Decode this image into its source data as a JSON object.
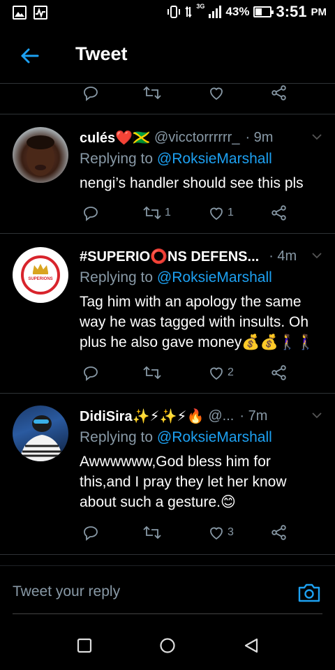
{
  "statusbar": {
    "network_label": "3G",
    "battery_percent": "43%",
    "battery_level": 0.43,
    "time": "3:51",
    "ampm": "PM"
  },
  "header": {
    "title": "Tweet"
  },
  "top_actions": {
    "reply_count": "",
    "retweet_count": "",
    "like_count": ""
  },
  "tweets": [
    {
      "name": "culés❤️🇯🇲",
      "handle": "@vicctorrrrrr_",
      "time": "· 9m",
      "replying_prefix": "Replying to",
      "replying_to": "@RoksieMarshall",
      "text": "nengi’s handler should see this pls",
      "reply_count": "",
      "retweet_count": "1",
      "like_count": "1"
    },
    {
      "name": "#SUPERIO⭕NS DEFENS...",
      "handle": "",
      "time": "· 4m",
      "replying_prefix": "Replying to",
      "replying_to": "@RoksieMarshall",
      "text": "Tag him with an apology the same way he was tagged with insults. Oh plus he also gave money💰💰🚶‍♀️🚶‍♀️",
      "reply_count": "",
      "retweet_count": "",
      "like_count": "2",
      "avatar_text": "SUPERIONS"
    },
    {
      "name": "DidiSira✨⚡✨⚡🔥",
      "handle": "@...",
      "time": "· 7m",
      "replying_prefix": "Replying to",
      "replying_to": "@RoksieMarshall",
      "text": "Awwwwww,God bless him for this,and I pray they let her know about such a gesture.😊",
      "reply_count": "",
      "retweet_count": "",
      "like_count": "3"
    }
  ],
  "reply_bar": {
    "placeholder": "Tweet your reply"
  },
  "colors": {
    "accent": "#1da1f2",
    "muted": "#8899a6",
    "divider": "#2f3336",
    "superions_red": "#d8242c",
    "superions_gold": "#d9a520"
  },
  "icons": [
    "gallery-icon",
    "activity-icon",
    "vibrate-icon",
    "signal-icon",
    "battery-icon",
    "back-arrow-icon",
    "reply-icon",
    "retweet-icon",
    "like-icon",
    "share-icon",
    "chevron-down-icon",
    "camera-icon",
    "recents-icon",
    "home-icon",
    "back-nav-icon"
  ]
}
